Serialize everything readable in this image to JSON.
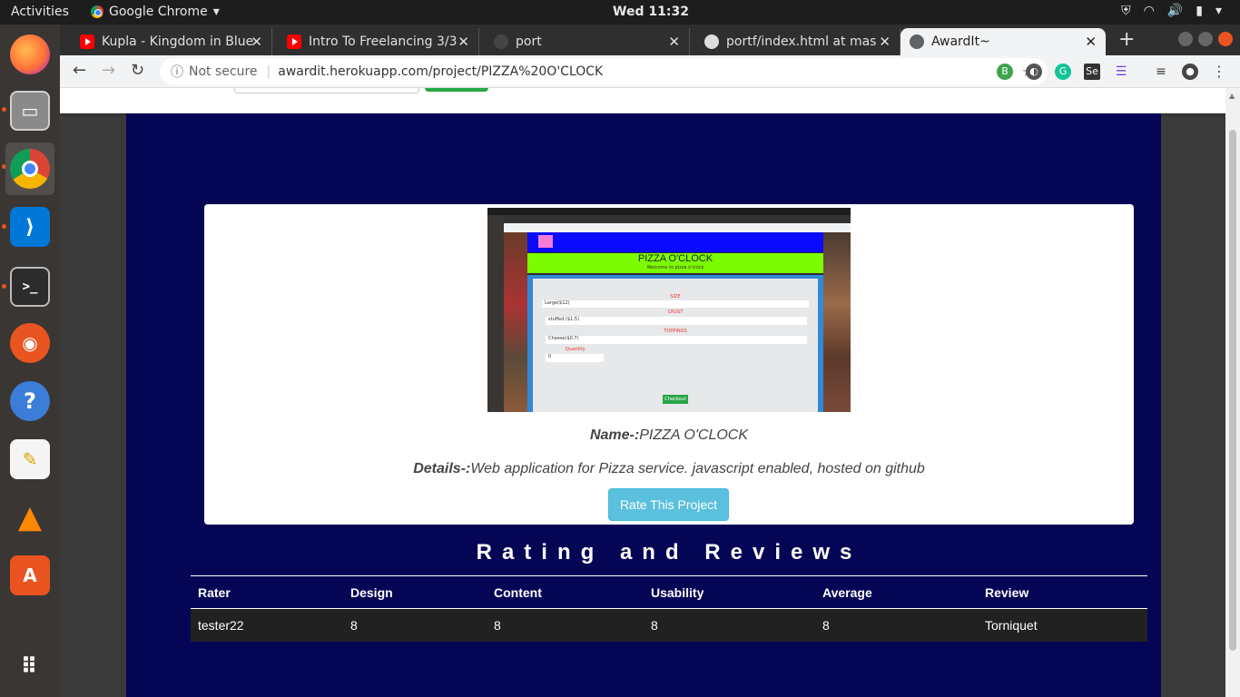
{
  "desktop": {
    "activities": "Activities",
    "app_name": "Google Chrome",
    "clock": "Wed 11:32"
  },
  "dock": [
    {
      "name": "firefox-icon",
      "color": "#ff7139"
    },
    {
      "name": "files-icon",
      "color": "#a8a8a8"
    },
    {
      "name": "chrome-icon",
      "color": "#4285f4"
    },
    {
      "name": "vscode-icon",
      "color": "#0078d7"
    },
    {
      "name": "terminal-icon",
      "color": "#2c2c2c"
    },
    {
      "name": "ubuntu-icon",
      "color": "#e95420"
    },
    {
      "name": "help-icon",
      "color": "#3b7dd8"
    },
    {
      "name": "text-editor-icon",
      "color": "#f5f5f5"
    },
    {
      "name": "vlc-icon",
      "color": "#ff8800"
    },
    {
      "name": "software-center-icon",
      "color": "#e95420"
    },
    {
      "name": "app-grid-icon",
      "color": "#3a3634"
    }
  ],
  "tabs": [
    {
      "title": "Kupla - Kingdom in Blue",
      "favicon": "youtube-icon"
    },
    {
      "title": "Intro To Freelancing 3/3",
      "favicon": "youtube-icon"
    },
    {
      "title": "port",
      "favicon": "globe-icon"
    },
    {
      "title": "portf/index.html at mas",
      "favicon": "github-icon"
    },
    {
      "title": "AwardIt~",
      "favicon": "globe-icon"
    }
  ],
  "address_bar": {
    "security": "Not secure",
    "url": "awardit.herokuapp.com/project/PIZZA%20O'CLOCK"
  },
  "extensions": [
    "B",
    "",
    "",
    "Se",
    "",
    ""
  ],
  "project": {
    "name_label": "Name-:",
    "name": "PIZZA O'CLOCK",
    "details_label": "Details-:",
    "details": "Web application for Pizza service. javascript enabled, hosted on github",
    "rate_button": "Rate This Project",
    "screenshot": {
      "title": "PIZZA O'CLOCK",
      "subtitle": "Welcome to pizza o'clock",
      "size_label": "SIZE",
      "size_value": "Large($12)",
      "crust_label": "CRUST",
      "crust_value": "stuffed ($1.5)",
      "toppings_label": "TOPPINGS",
      "toppings_value": "Cheese($0.7)",
      "quantity_label": "Quantity",
      "quantity_value": "0",
      "checkout": "Checkout"
    }
  },
  "reviews": {
    "title": "Rating and Reviews",
    "columns": [
      "Rater",
      "Design",
      "Content",
      "Usability",
      "Average",
      "Review"
    ],
    "rows": [
      [
        "tester22",
        "8",
        "8",
        "8",
        "8",
        "Torniquet"
      ]
    ]
  },
  "colors": {
    "page_background": "#050556",
    "rate_button": "#5bc0de",
    "table_row": "#212121"
  }
}
